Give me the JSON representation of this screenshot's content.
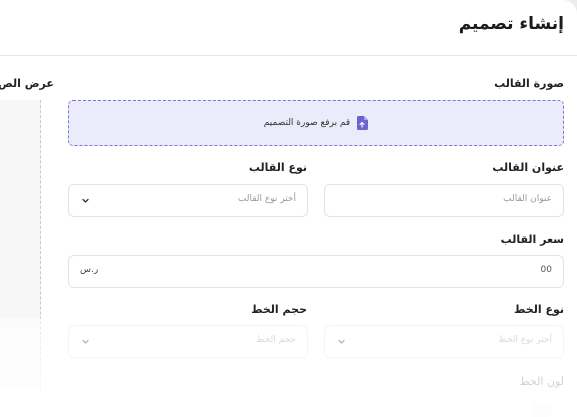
{
  "page": {
    "title": "إنشاء تصميم"
  },
  "side_panel": {
    "label": "عرض الص"
  },
  "upload": {
    "label": "صورة القالب",
    "text": "قم برفع صورة التصميم",
    "icon": "upload-file-icon"
  },
  "template_title": {
    "label": "عنوان القالب",
    "placeholder": "عنوان القالب"
  },
  "template_type": {
    "label": "نوع القالب",
    "placeholder": "أختر نوع القالب"
  },
  "template_price": {
    "label": "سعر القالب",
    "value": "00",
    "unit": "ر.س"
  },
  "font_type": {
    "label": "نوع الخط",
    "placeholder": "أختر نوع الخط"
  },
  "font_size": {
    "label": "حجم الخط",
    "placeholder": "حجم الخط"
  },
  "font_color": {
    "label": "لون الخط"
  },
  "colors": {
    "accent": "#7b76d3",
    "upload_bg": "#ebebfb",
    "border": "#e3e3e3"
  }
}
